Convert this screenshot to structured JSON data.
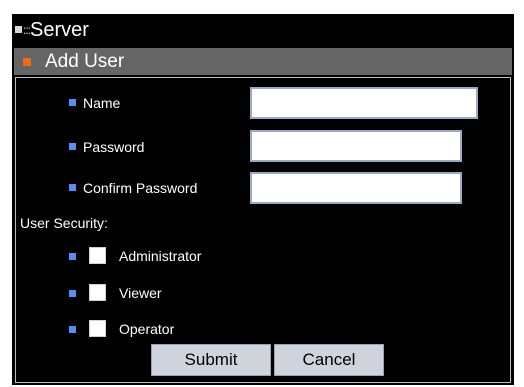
{
  "window": {
    "title": "Server"
  },
  "section": {
    "title": "Add User"
  },
  "form": {
    "name_label": "Name",
    "name_value": "",
    "password_label": "Password",
    "password_value": "",
    "confirm_label": "Confirm Password",
    "confirm_value": "",
    "security_heading": "User Security:",
    "roles": [
      {
        "label": "Administrator",
        "checked": false
      },
      {
        "label": "Viewer",
        "checked": false
      },
      {
        "label": "Operator",
        "checked": false
      }
    ]
  },
  "buttons": {
    "submit": "Submit",
    "cancel": "Cancel"
  },
  "colors": {
    "background": "#000000",
    "subheader": "#656565",
    "accent_orange": "#f06a18",
    "bullet_blue": "#5b8cf0",
    "button_bg": "#cfd3db"
  }
}
